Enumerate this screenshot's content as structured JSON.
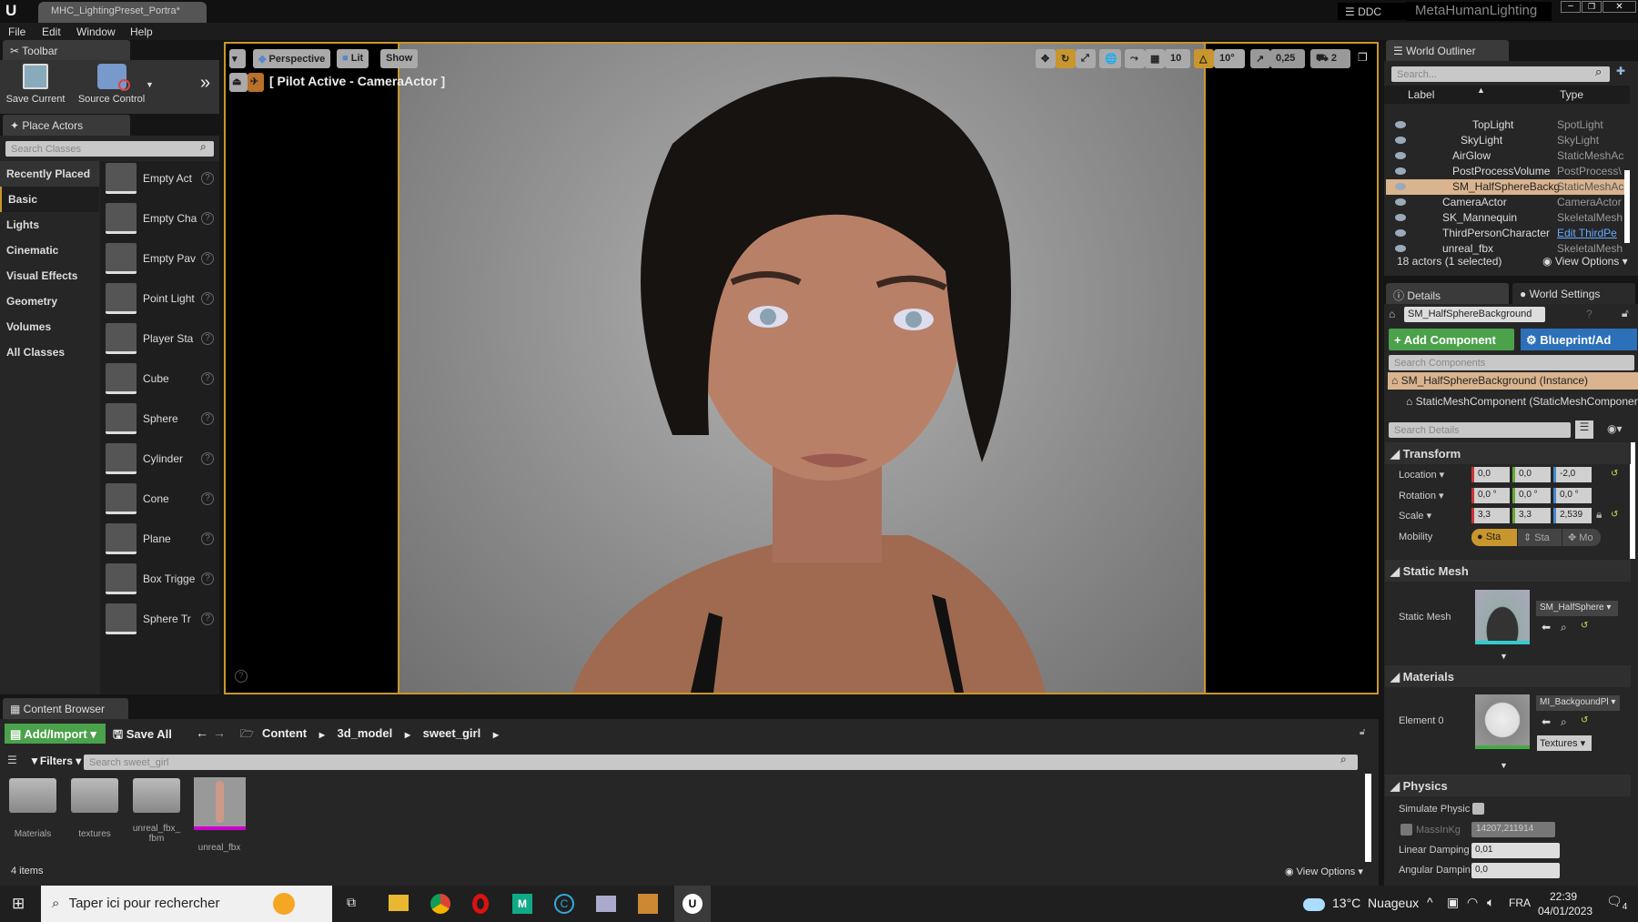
{
  "title_bar": {
    "tab": "MHC_LightingPreset_Portra*",
    "ddc": "DDC",
    "project": "MetaHumanLighting"
  },
  "menu": [
    "File",
    "Edit",
    "Window",
    "Help"
  ],
  "toolbar": {
    "tab": "Toolbar",
    "save": "Save Current",
    "source": "Source Control"
  },
  "place_actors": {
    "tab": "Place Actors",
    "search_placeholder": "Search Classes",
    "categories": [
      "Recently Placed",
      "Basic",
      "Lights",
      "Cinematic",
      "Visual Effects",
      "Geometry",
      "Volumes",
      "All Classes"
    ],
    "selected_category": "Basic",
    "items": [
      "Empty Act",
      "Empty Cha",
      "Empty Pav",
      "Point Light",
      "Player Sta",
      "Cube",
      "Sphere",
      "Cylinder",
      "Cone",
      "Plane",
      "Box Trigge",
      "Sphere Tr"
    ]
  },
  "viewport": {
    "perspective": "Perspective",
    "lit": "Lit",
    "show": "Show",
    "pilot": "[ Pilot Active - CameraActor ]",
    "grid": "10",
    "angle": "10°",
    "scale": "0,25",
    "camera_speed": "2",
    "accent": "#c8962c"
  },
  "outliner": {
    "tab": "World Outliner",
    "search_placeholder": "Search...",
    "col_label": "Label",
    "col_type": "Type",
    "rows": [
      {
        "label": "TopLight",
        "type": "SpotLight"
      },
      {
        "label": "SkyLight",
        "type": "SkyLight"
      },
      {
        "label": "AirGlow",
        "type": "StaticMeshAc"
      },
      {
        "label": "PostProcessVolume",
        "type": "PostProcess\\"
      },
      {
        "label": "SM_HalfSphereBackg",
        "type": "StaticMeshAc",
        "selected": true
      },
      {
        "label": "CameraActor",
        "type": "CameraActor"
      },
      {
        "label": "SK_Mannequin",
        "type": "SkeletalMesh"
      },
      {
        "label": "ThirdPersonCharacter",
        "type": "Edit ThirdPe"
      },
      {
        "label": "unreal_fbx",
        "type": "SkeletalMesh"
      }
    ],
    "status": "18 actors (1 selected)",
    "view_options": "View Options"
  },
  "details": {
    "tab": "Details",
    "tab2": "World Settings",
    "name": "SM_HalfSphereBackground",
    "add_component": "+ Add Component",
    "blueprint": "Blueprint/Ad",
    "search_components": "Search Components",
    "instance": "SM_HalfSphereBackground (Instance)",
    "component": "StaticMeshComponent (StaticMeshComponent",
    "search_details": "Search Details",
    "transform": "Transform",
    "location_label": "Location",
    "location": [
      "0,0",
      "0,0",
      "-2,0"
    ],
    "rotation_label": "Rotation",
    "rotation": [
      "0,0 °",
      "0,0 °",
      "0,0 °"
    ],
    "scale_label": "Scale",
    "scale": [
      "3,3",
      "3,3",
      "2,539"
    ],
    "mobility_label": "Mobility",
    "mobility": [
      "Sta",
      "Sta",
      "Mo"
    ],
    "static_mesh_section": "Static Mesh",
    "static_mesh_label": "Static Mesh",
    "static_mesh_value": "SM_HalfSphere",
    "materials_section": "Materials",
    "element_label": "Element 0",
    "material_value": "MI_BackgoundPl",
    "textures": "Textures",
    "physics_section": "Physics",
    "simulate": "Simulate Physic",
    "mass_label": "MassInKg",
    "mass": "14207,211914",
    "linear_label": "Linear Damping",
    "linear": "0,01",
    "angular_label": "Angular Dampin",
    "angular": "0,0"
  },
  "content_browser": {
    "tab": "Content Browser",
    "add_import": "Add/Import",
    "save_all": "Save All",
    "path": [
      "Content",
      "3d_model",
      "sweet_girl"
    ],
    "filters": "Filters",
    "search_placeholder": "Search sweet_girl",
    "assets": [
      "Materials",
      "textures",
      "unreal_fbx_ fbm",
      "unreal_fbx"
    ],
    "count": "4 items",
    "view_options": "View Options"
  },
  "taskbar": {
    "search": "Taper ici pour rechercher",
    "weather": "13°C  Nuageux",
    "lang": "FRA",
    "time": "22:39",
    "date": "04/01/2023",
    "notifications": "4"
  }
}
